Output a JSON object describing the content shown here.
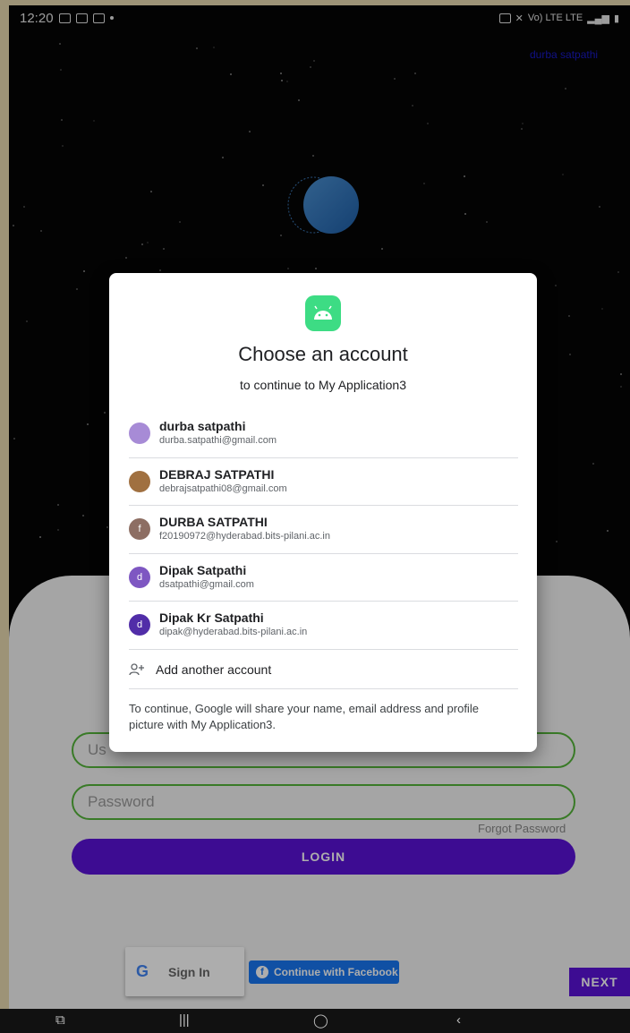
{
  "status_bar": {
    "time": "12:20",
    "right_text": "Vo) LTE LTE"
  },
  "background": {
    "corner_user": "durba satpathi"
  },
  "dialog": {
    "title": "Choose an account",
    "subtitle": "to continue to My Application3",
    "accounts": [
      {
        "name": "durba satpathi",
        "email": "durba.satpathi@gmail.com",
        "avatar_letter": "",
        "avatar_color": "#a78bd6"
      },
      {
        "name": "DEBRAJ SATPATHI",
        "email": "debrajsatpathi08@gmail.com",
        "avatar_letter": "",
        "avatar_color": "#a07040"
      },
      {
        "name": "DURBA SATPATHI",
        "email": "f20190972@hyderabad.bits-pilani.ac.in",
        "avatar_letter": "f",
        "avatar_color": "#8d6e63"
      },
      {
        "name": "Dipak Satpathi",
        "email": "dsatpathi@gmail.com",
        "avatar_letter": "d",
        "avatar_color": "#7e57c2"
      },
      {
        "name": "Dipak Kr Satpathi",
        "email": "dipak@hyderabad.bits-pilani.ac.in",
        "avatar_letter": "d",
        "avatar_color": "#512da8"
      }
    ],
    "add_account_label": "Add another account",
    "privacy_notice": "To continue, Google will share your name, email address and profile picture with My Application3."
  },
  "login": {
    "username_placeholder": "Us",
    "password_placeholder": "Password",
    "forgot_password": "Forgot Password",
    "login_label": "LOGIN",
    "google_label": "Sign In",
    "google_glyph": "G",
    "facebook_label": "Continue with Facebook",
    "next_label": "NEXT"
  },
  "colors": {
    "accent": "#5a12d8",
    "field_border": "#55b43a",
    "android_green": "#3ddc84"
  }
}
